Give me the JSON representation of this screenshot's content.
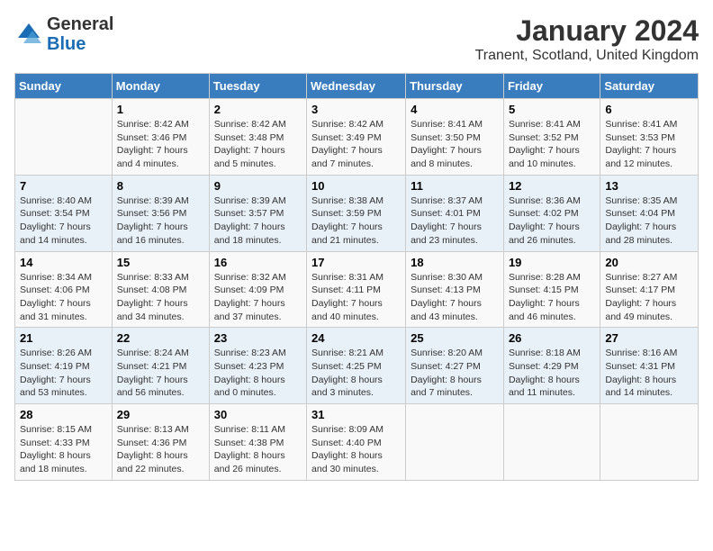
{
  "logo": {
    "general": "General",
    "blue": "Blue"
  },
  "title": "January 2024",
  "subtitle": "Tranent, Scotland, United Kingdom",
  "days_of_week": [
    "Sunday",
    "Monday",
    "Tuesday",
    "Wednesday",
    "Thursday",
    "Friday",
    "Saturday"
  ],
  "weeks": [
    [
      {
        "day": "",
        "sunrise": "",
        "sunset": "",
        "daylight": ""
      },
      {
        "day": "1",
        "sunrise": "Sunrise: 8:42 AM",
        "sunset": "Sunset: 3:46 PM",
        "daylight": "Daylight: 7 hours and 4 minutes."
      },
      {
        "day": "2",
        "sunrise": "Sunrise: 8:42 AM",
        "sunset": "Sunset: 3:48 PM",
        "daylight": "Daylight: 7 hours and 5 minutes."
      },
      {
        "day": "3",
        "sunrise": "Sunrise: 8:42 AM",
        "sunset": "Sunset: 3:49 PM",
        "daylight": "Daylight: 7 hours and 7 minutes."
      },
      {
        "day": "4",
        "sunrise": "Sunrise: 8:41 AM",
        "sunset": "Sunset: 3:50 PM",
        "daylight": "Daylight: 7 hours and 8 minutes."
      },
      {
        "day": "5",
        "sunrise": "Sunrise: 8:41 AM",
        "sunset": "Sunset: 3:52 PM",
        "daylight": "Daylight: 7 hours and 10 minutes."
      },
      {
        "day": "6",
        "sunrise": "Sunrise: 8:41 AM",
        "sunset": "Sunset: 3:53 PM",
        "daylight": "Daylight: 7 hours and 12 minutes."
      }
    ],
    [
      {
        "day": "7",
        "sunrise": "Sunrise: 8:40 AM",
        "sunset": "Sunset: 3:54 PM",
        "daylight": "Daylight: 7 hours and 14 minutes."
      },
      {
        "day": "8",
        "sunrise": "Sunrise: 8:39 AM",
        "sunset": "Sunset: 3:56 PM",
        "daylight": "Daylight: 7 hours and 16 minutes."
      },
      {
        "day": "9",
        "sunrise": "Sunrise: 8:39 AM",
        "sunset": "Sunset: 3:57 PM",
        "daylight": "Daylight: 7 hours and 18 minutes."
      },
      {
        "day": "10",
        "sunrise": "Sunrise: 8:38 AM",
        "sunset": "Sunset: 3:59 PM",
        "daylight": "Daylight: 7 hours and 21 minutes."
      },
      {
        "day": "11",
        "sunrise": "Sunrise: 8:37 AM",
        "sunset": "Sunset: 4:01 PM",
        "daylight": "Daylight: 7 hours and 23 minutes."
      },
      {
        "day": "12",
        "sunrise": "Sunrise: 8:36 AM",
        "sunset": "Sunset: 4:02 PM",
        "daylight": "Daylight: 7 hours and 26 minutes."
      },
      {
        "day": "13",
        "sunrise": "Sunrise: 8:35 AM",
        "sunset": "Sunset: 4:04 PM",
        "daylight": "Daylight: 7 hours and 28 minutes."
      }
    ],
    [
      {
        "day": "14",
        "sunrise": "Sunrise: 8:34 AM",
        "sunset": "Sunset: 4:06 PM",
        "daylight": "Daylight: 7 hours and 31 minutes."
      },
      {
        "day": "15",
        "sunrise": "Sunrise: 8:33 AM",
        "sunset": "Sunset: 4:08 PM",
        "daylight": "Daylight: 7 hours and 34 minutes."
      },
      {
        "day": "16",
        "sunrise": "Sunrise: 8:32 AM",
        "sunset": "Sunset: 4:09 PM",
        "daylight": "Daylight: 7 hours and 37 minutes."
      },
      {
        "day": "17",
        "sunrise": "Sunrise: 8:31 AM",
        "sunset": "Sunset: 4:11 PM",
        "daylight": "Daylight: 7 hours and 40 minutes."
      },
      {
        "day": "18",
        "sunrise": "Sunrise: 8:30 AM",
        "sunset": "Sunset: 4:13 PM",
        "daylight": "Daylight: 7 hours and 43 minutes."
      },
      {
        "day": "19",
        "sunrise": "Sunrise: 8:28 AM",
        "sunset": "Sunset: 4:15 PM",
        "daylight": "Daylight: 7 hours and 46 minutes."
      },
      {
        "day": "20",
        "sunrise": "Sunrise: 8:27 AM",
        "sunset": "Sunset: 4:17 PM",
        "daylight": "Daylight: 7 hours and 49 minutes."
      }
    ],
    [
      {
        "day": "21",
        "sunrise": "Sunrise: 8:26 AM",
        "sunset": "Sunset: 4:19 PM",
        "daylight": "Daylight: 7 hours and 53 minutes."
      },
      {
        "day": "22",
        "sunrise": "Sunrise: 8:24 AM",
        "sunset": "Sunset: 4:21 PM",
        "daylight": "Daylight: 7 hours and 56 minutes."
      },
      {
        "day": "23",
        "sunrise": "Sunrise: 8:23 AM",
        "sunset": "Sunset: 4:23 PM",
        "daylight": "Daylight: 8 hours and 0 minutes."
      },
      {
        "day": "24",
        "sunrise": "Sunrise: 8:21 AM",
        "sunset": "Sunset: 4:25 PM",
        "daylight": "Daylight: 8 hours and 3 minutes."
      },
      {
        "day": "25",
        "sunrise": "Sunrise: 8:20 AM",
        "sunset": "Sunset: 4:27 PM",
        "daylight": "Daylight: 8 hours and 7 minutes."
      },
      {
        "day": "26",
        "sunrise": "Sunrise: 8:18 AM",
        "sunset": "Sunset: 4:29 PM",
        "daylight": "Daylight: 8 hours and 11 minutes."
      },
      {
        "day": "27",
        "sunrise": "Sunrise: 8:16 AM",
        "sunset": "Sunset: 4:31 PM",
        "daylight": "Daylight: 8 hours and 14 minutes."
      }
    ],
    [
      {
        "day": "28",
        "sunrise": "Sunrise: 8:15 AM",
        "sunset": "Sunset: 4:33 PM",
        "daylight": "Daylight: 8 hours and 18 minutes."
      },
      {
        "day": "29",
        "sunrise": "Sunrise: 8:13 AM",
        "sunset": "Sunset: 4:36 PM",
        "daylight": "Daylight: 8 hours and 22 minutes."
      },
      {
        "day": "30",
        "sunrise": "Sunrise: 8:11 AM",
        "sunset": "Sunset: 4:38 PM",
        "daylight": "Daylight: 8 hours and 26 minutes."
      },
      {
        "day": "31",
        "sunrise": "Sunrise: 8:09 AM",
        "sunset": "Sunset: 4:40 PM",
        "daylight": "Daylight: 8 hours and 30 minutes."
      },
      {
        "day": "",
        "sunrise": "",
        "sunset": "",
        "daylight": ""
      },
      {
        "day": "",
        "sunrise": "",
        "sunset": "",
        "daylight": ""
      },
      {
        "day": "",
        "sunrise": "",
        "sunset": "",
        "daylight": ""
      }
    ]
  ]
}
